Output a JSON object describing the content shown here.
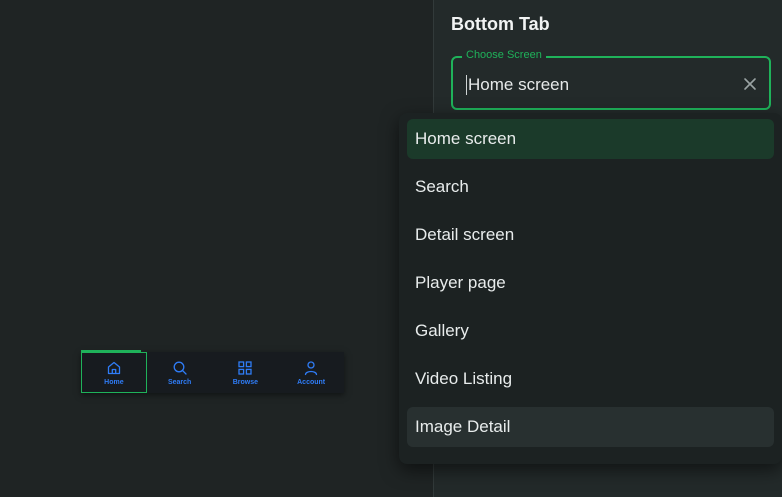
{
  "tabbar": {
    "items": [
      {
        "label": "Home",
        "icon": "home-icon"
      },
      {
        "label": "Search",
        "icon": "search-icon"
      },
      {
        "label": "Browse",
        "icon": "grid-icon"
      },
      {
        "label": "Account",
        "icon": "user-icon"
      }
    ],
    "active_index": 0
  },
  "panel": {
    "title": "Bottom Tab",
    "field": {
      "label": "Choose Screen",
      "value": "Home screen"
    }
  },
  "dropdown": {
    "options": [
      {
        "label": "Home screen",
        "state": "selected"
      },
      {
        "label": "Search",
        "state": "normal"
      },
      {
        "label": "Detail screen",
        "state": "normal"
      },
      {
        "label": "Player page",
        "state": "normal"
      },
      {
        "label": "Gallery",
        "state": "normal"
      },
      {
        "label": "Video Listing",
        "state": "normal"
      },
      {
        "label": "Image Detail",
        "state": "hovered"
      }
    ]
  },
  "colors": {
    "accent_green": "#1fb25a",
    "tab_blue": "#2f7cf6",
    "selected_option_bg": "#1b3a2a"
  }
}
